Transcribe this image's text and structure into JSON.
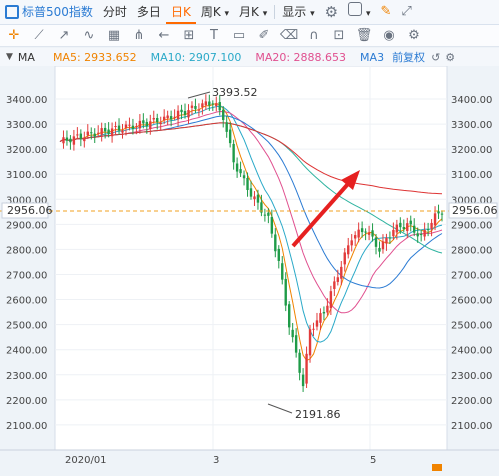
{
  "topbar": {
    "index_name": "标普500指数",
    "tabs": [
      "分时",
      "多日",
      "日K",
      "周K",
      "月K"
    ],
    "active_tab": "日K",
    "display_label": "显示"
  },
  "ma_bar": {
    "main_label": "MA",
    "ma5": "MA5: 2933.652",
    "ma10": "MA10: 2907.100",
    "ma20": "MA20: 2888.653",
    "ma3": "MA3",
    "adjust": "前复权",
    "colors": {
      "ma5": "#f08300",
      "ma10": "#2aa9c8",
      "ma20": "#e0508f",
      "ma3": "#2b7bd3"
    }
  },
  "chart": {
    "y_ticks": [
      "3400.00",
      "3300.00",
      "3200.00",
      "3100.00",
      "3000.00",
      "2900.00",
      "2800.00",
      "2700.00",
      "2600.00",
      "2500.00",
      "2400.00",
      "2300.00",
      "2200.00",
      "2100.00"
    ],
    "x_ticks": [
      "2020/01",
      "3",
      "5"
    ],
    "high_label": "3393.52",
    "low_label": "2191.86",
    "current_price": "2956.06",
    "up_color": "#e23b3b",
    "down_color": "#1f9b48"
  }
}
